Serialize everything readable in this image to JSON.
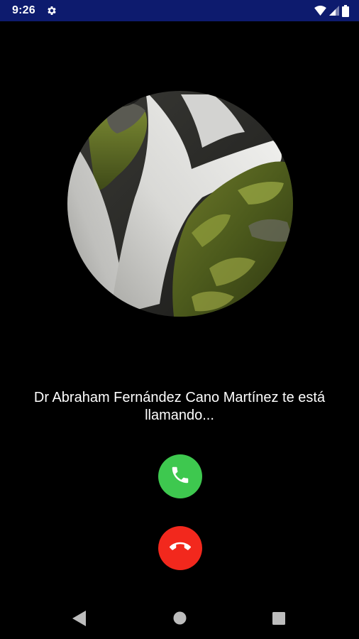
{
  "status_bar": {
    "time": "9:26",
    "background": "#0d1b6e",
    "icons": [
      "settings-gear-icon",
      "wifi-icon",
      "signal-icon",
      "battery-icon"
    ]
  },
  "avatar": {
    "description_icon": "waterfall-photo"
  },
  "caller": {
    "message": "Dr Abraham Fernández Cano Martínez te está llamando..."
  },
  "actions": {
    "answer_icon": "phone-icon",
    "answer_color": "#3ec84f",
    "decline_icon": "phone-hangup-icon",
    "decline_color": "#f2281d"
  },
  "nav_bar": {
    "icons": [
      "back-icon",
      "home-icon",
      "recents-icon"
    ]
  }
}
